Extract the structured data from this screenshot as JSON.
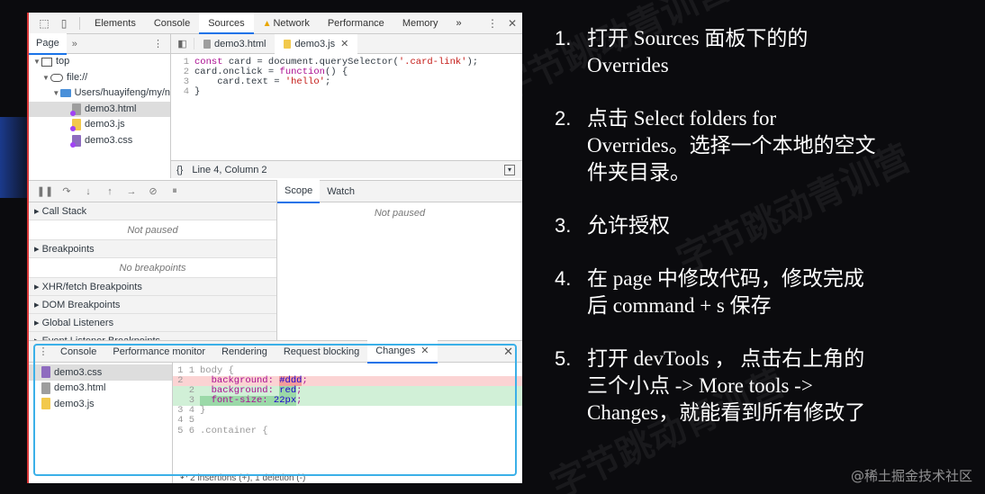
{
  "devtools": {
    "main_tabs": [
      {
        "label": "Elements"
      },
      {
        "label": "Console"
      },
      {
        "label": "Sources"
      },
      {
        "label": "Network"
      },
      {
        "label": "Performance"
      },
      {
        "label": "Memory"
      }
    ],
    "more_tabs": "»",
    "navigator": {
      "tab": "Page",
      "more": "»",
      "tree": [
        {
          "label": "top"
        },
        {
          "label": "file://"
        },
        {
          "label": "Users/huayifeng/my/n"
        },
        {
          "label": "demo3.html"
        },
        {
          "label": "demo3.js"
        },
        {
          "label": "demo3.css"
        }
      ]
    },
    "editor": {
      "tabs": [
        {
          "label": "demo3.html"
        },
        {
          "label": "demo3.js"
        }
      ],
      "code": {
        "l1": {
          "n": "1",
          "kw": "const",
          "a": " card = document.querySelector(",
          "s": "'.card-link'",
          "b": ");"
        },
        "l2": {
          "n": "2",
          "a": "card.onclick = ",
          "kw": "function",
          "b": "() {"
        },
        "l3": {
          "n": "3",
          "a": "    card.text = ",
          "s": "'hello'",
          "b": ";"
        },
        "l4": {
          "n": "4",
          "a": "}"
        }
      },
      "status_braces": "{}",
      "status_position": "Line 4, Column 2"
    },
    "debugger": {
      "panes": [
        {
          "title": "Call Stack",
          "empty": "Not paused"
        },
        {
          "title": "Breakpoints",
          "empty": "No breakpoints"
        }
      ],
      "collapsed": [
        "XHR/fetch Breakpoints",
        "DOM Breakpoints",
        "Global Listeners",
        "Event Listener Breakpoints"
      ],
      "scope_tabs": [
        "Scope",
        "Watch"
      ],
      "scope_empty": "Not paused"
    },
    "drawer": {
      "tabs": [
        "Console",
        "Performance monitor",
        "Rendering",
        "Request blocking",
        "Changes"
      ],
      "files": [
        "demo3.css",
        "demo3.html",
        "demo3.js"
      ],
      "diff": {
        "d1": {
          "n": "1 1",
          "code": "body {"
        },
        "d2": {
          "n": "2  ",
          "prop": "  background: ",
          "val": "#ddd",
          "end": ";"
        },
        "d3": {
          "n": "  2",
          "prop": "  background: ",
          "val": "red",
          "end": ";"
        },
        "d4": {
          "n": "  3",
          "prop": "  font-size: ",
          "val": "22px",
          "end": ";"
        },
        "d5": {
          "n": "3 4",
          "code": "}"
        },
        "d6": {
          "n": "4 5",
          "code": ""
        },
        "d7": {
          "n": "5 6",
          "code": ".container {"
        }
      },
      "footer": "2 insertions (+), 1 deletion (-)"
    }
  },
  "instructions": [
    {
      "num": "1.",
      "lines": [
        "打开 Sources 面板下的的",
        "Overrides"
      ]
    },
    {
      "num": "2.",
      "lines": [
        "点击 Select folders for",
        "Overrides。选择一个本地的空文",
        "件夹目录。"
      ]
    },
    {
      "num": "3.",
      "lines": [
        "允许授权"
      ]
    },
    {
      "num": "4.",
      "lines": [
        "在 page 中修改代码，修改完成",
        "后 command + s 保存"
      ]
    },
    {
      "num": "5.",
      "lines": [
        "打开 devTools ， 点击右上角的",
        "三个小点 -> More tools ->",
        "Changes，就能看到所有修改了"
      ]
    }
  ],
  "watermark": "@稀土掘金技术社区",
  "colors": {
    "accent": "#1a73e8",
    "highlight": "#3bb0e8",
    "background": "#0b0b0e"
  }
}
